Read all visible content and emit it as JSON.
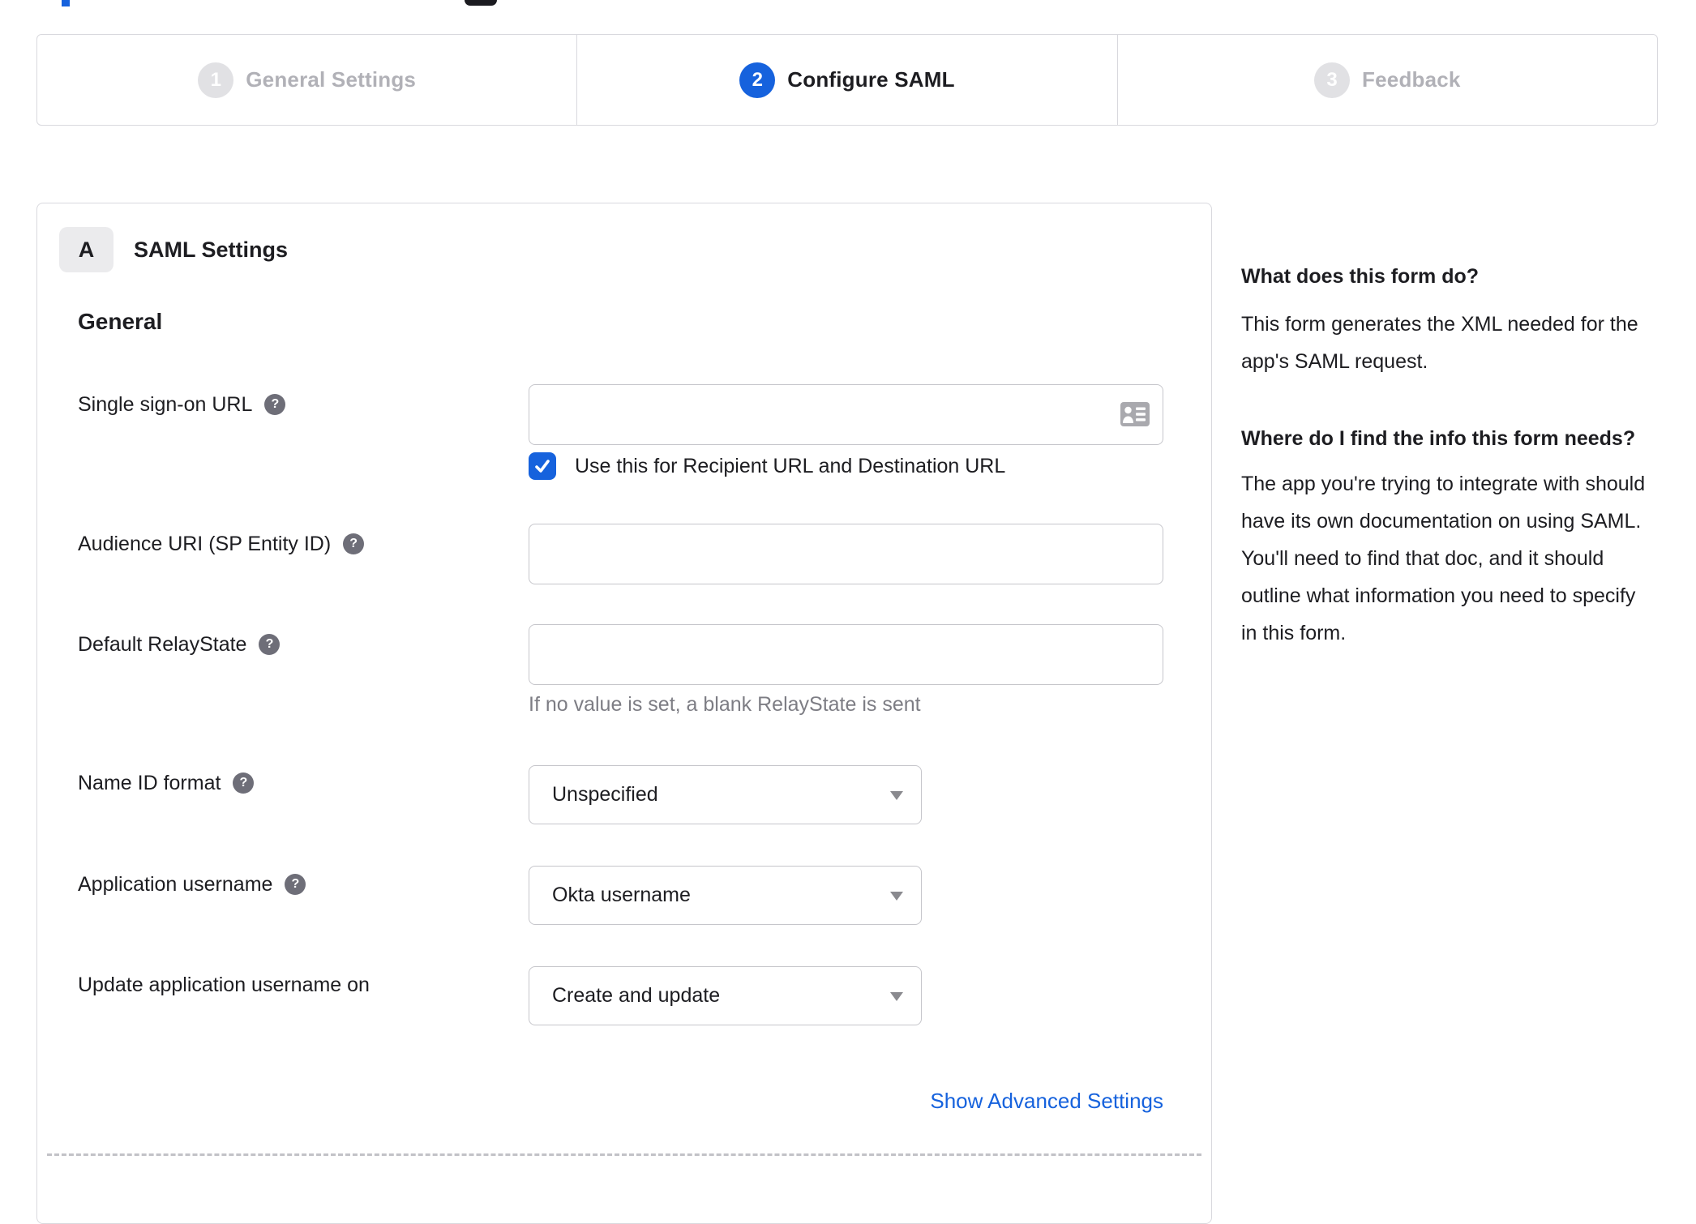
{
  "theme": {
    "accent_color": "#1662dd",
    "text_color": "#1d1d21",
    "muted_text_color": "#7d7d84",
    "border_color": "#d9d9de",
    "inactive_step_circle_color": "#e1e1e4",
    "inactive_step_label_color": "#b1b1b7",
    "header_fragment_dark_color": "#1b1b20"
  },
  "stepper": {
    "steps": [
      {
        "number": "1",
        "label": "General Settings",
        "active": false
      },
      {
        "number": "2",
        "label": "Configure SAML",
        "active": true
      },
      {
        "number": "3",
        "label": "Feedback",
        "active": false
      }
    ]
  },
  "panel": {
    "badge": "A",
    "title": "SAML Settings",
    "section_heading": "General",
    "sso": {
      "label": "Single sign-on URL",
      "value": "",
      "checkbox_label": "Use this for Recipient URL and Destination URL",
      "checkbox_checked": true
    },
    "audience": {
      "label": "Audience URI (SP Entity ID)",
      "value": ""
    },
    "relay_state": {
      "label": "Default RelayState",
      "value": "",
      "hint": "If no value is set, a blank RelayState is sent"
    },
    "name_id_format": {
      "label": "Name ID format",
      "value": "Unspecified"
    },
    "application_username": {
      "label": "Application username",
      "value": "Okta username"
    },
    "update_application_username_on": {
      "label": "Update application username on",
      "value": "Create and update"
    },
    "advanced_link": "Show Advanced Settings"
  },
  "help_panel": {
    "q1": "What does this form do?",
    "a1": "This form generates the XML needed for the app's SAML request.",
    "q2": "Where do I find the info this form needs?",
    "a2": "The app you're trying to integrate with should have its own documentation on using SAML. You'll need to find that doc, and it should outline what information you need to specify in this form."
  },
  "icons": {
    "help_glyph": "?"
  }
}
